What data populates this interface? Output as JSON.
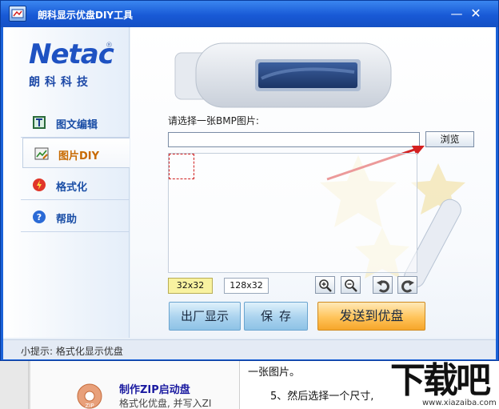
{
  "window": {
    "title": "朗科显示优盘DIY工具",
    "minimize_glyph": "—",
    "close_glyph": "✕"
  },
  "brand": {
    "logo": "Netac",
    "registered": "®",
    "subtitle": "朗科科技"
  },
  "sidebar": {
    "items": [
      {
        "label": "图文编辑",
        "icon": "text-edit-icon"
      },
      {
        "label": "图片DIY",
        "icon": "picture-diy-icon",
        "active": true
      },
      {
        "label": "格式化",
        "icon": "format-icon"
      },
      {
        "label": "帮助",
        "icon": "help-icon"
      }
    ]
  },
  "main": {
    "prompt": "请选择一张BMP图片:",
    "path_value": "",
    "browse_label": "浏览",
    "size_options": [
      "32x32",
      "128x32"
    ],
    "selected_size": "32x32",
    "tools": [
      "zoom-in-icon",
      "zoom-out-icon",
      "rotate-left-icon",
      "rotate-right-icon"
    ],
    "factory_label": "出厂显示",
    "save_label": "保存",
    "send_label": "发送到优盘"
  },
  "status": {
    "tip": "小提示: 格式化显示优盘"
  },
  "background_page": {
    "link_title": "制作ZIP启动盘",
    "link_desc": "格式化优盘, 并写入ZI",
    "text_line1": "一张图片。",
    "text_line2": "5、然后选择一个尺寸,",
    "watermark": "下载吧",
    "watermark_url": "www.xiazaiba.com"
  },
  "colors": {
    "titlebar": "#1859d6",
    "accent_blue": "#1e52c2",
    "active_item": "#c86a00",
    "send_button": "#ffc35a",
    "selected_size_bg": "#f8f2a0",
    "arrow": "#d42020"
  }
}
